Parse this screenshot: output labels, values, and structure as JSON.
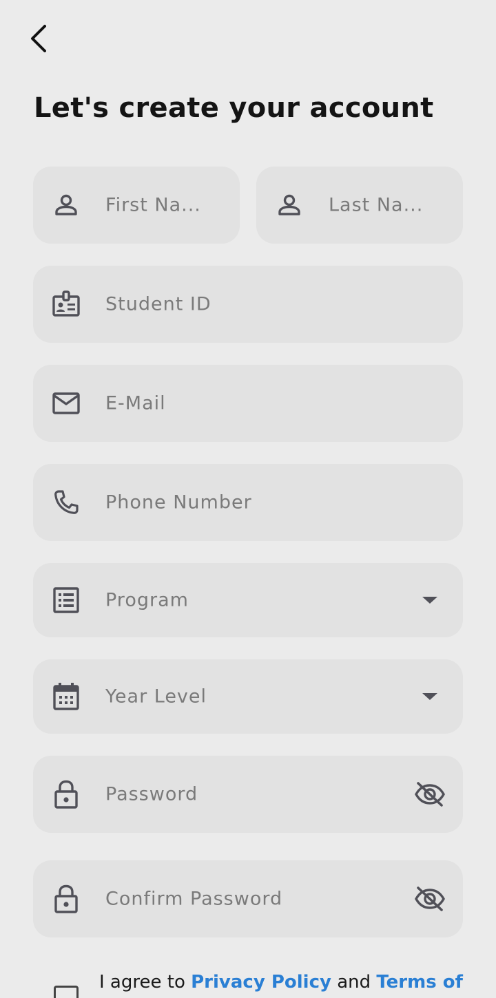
{
  "header": {
    "back_icon": "chevron-left-icon",
    "title": "Let's create your account"
  },
  "form": {
    "first_name": {
      "placeholder": "First Na...",
      "icon": "person-icon"
    },
    "last_name": {
      "placeholder": "Last Na...",
      "icon": "person-icon"
    },
    "student_id": {
      "placeholder": "Student ID",
      "icon": "id-badge-icon"
    },
    "email": {
      "placeholder": "E-Mail",
      "icon": "mail-icon"
    },
    "phone": {
      "placeholder": "Phone Number",
      "icon": "phone-icon"
    },
    "program": {
      "placeholder": "Program",
      "icon": "list-alt-icon",
      "dropdown_icon": "dropdown-arrow-icon"
    },
    "year_level": {
      "placeholder": "Year Level",
      "icon": "calendar-icon",
      "dropdown_icon": "dropdown-arrow-icon"
    },
    "password": {
      "placeholder": "Password",
      "icon": "lock-icon",
      "toggle_icon": "eye-off-icon"
    },
    "confirm_password": {
      "placeholder": "Confirm Password",
      "icon": "lock-icon",
      "toggle_icon": "eye-off-icon"
    }
  },
  "agreement": {
    "prefix": "I agree to ",
    "privacy_link": "Privacy Policy",
    "middle": " and ",
    "terms_link": "Terms of"
  },
  "colors": {
    "background": "#ebebeb",
    "field": "#e2e2e2",
    "icon": "#505058",
    "placeholder": "#7a7a7a",
    "link": "#2a7fd4"
  }
}
